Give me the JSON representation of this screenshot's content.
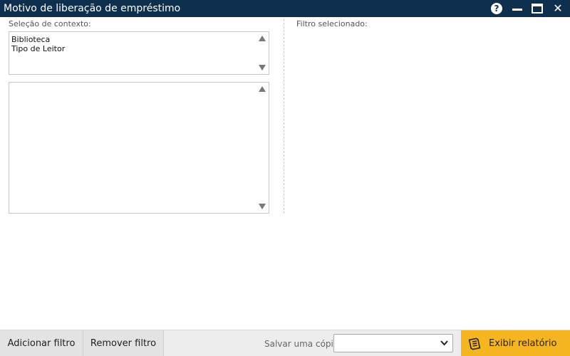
{
  "window": {
    "title": "Motivo de liberação de empréstimo",
    "help_glyph": "?",
    "close_glyph": "✕"
  },
  "context": {
    "label": "Seleção de contexto:",
    "items": [
      "Biblioteca",
      "Tipo de Leitor"
    ],
    "sub_items": []
  },
  "filter": {
    "label": "Filtro selecionado:"
  },
  "footer": {
    "add_filter": "Adicionar filtro",
    "remove_filter": "Remover filtro",
    "save_copy_label": "Salvar uma cópia:",
    "save_copy_value": "",
    "report_button": "Exibir relatório"
  },
  "colors": {
    "titlebar": "#0f2f4f",
    "report_button": "#f4b520"
  },
  "icons": {
    "help": "help-icon",
    "minimize": "minimize-icon",
    "maximize": "maximize-icon",
    "close": "close-icon",
    "report": "report-icon"
  }
}
